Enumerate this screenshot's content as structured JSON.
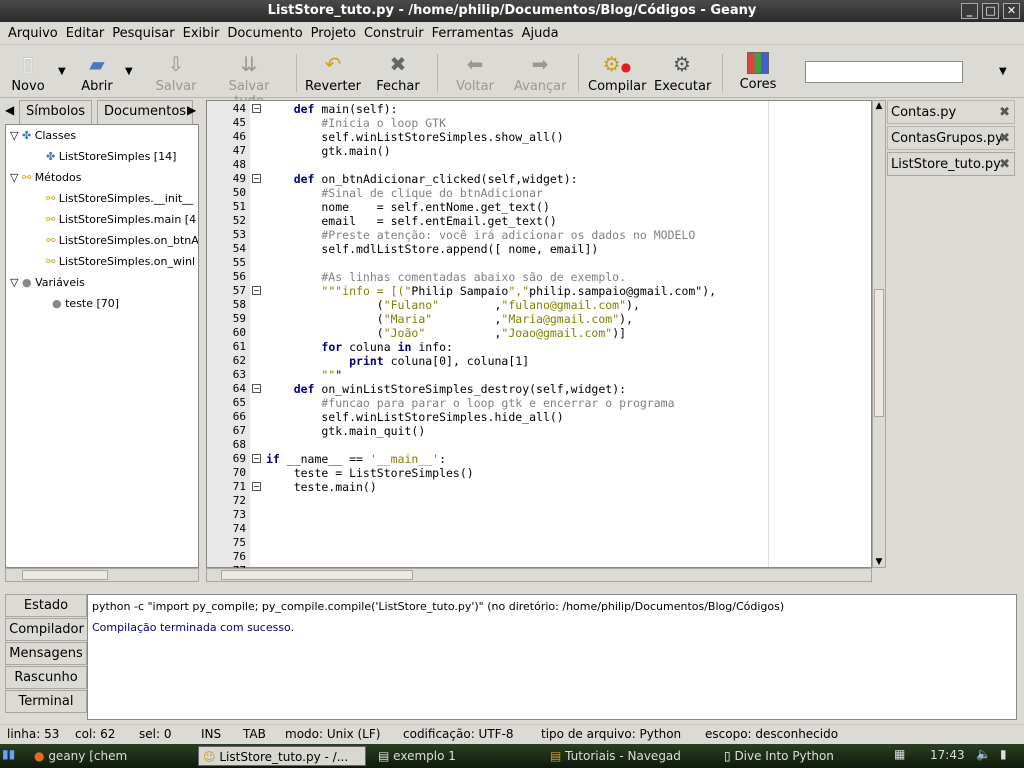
{
  "window": {
    "title": "ListStore_tuto.py - /home/philip/Documentos/Blog/Códigos - Geany"
  },
  "menu": [
    "Arquivo",
    "Editar",
    "Pesquisar",
    "Exibir",
    "Documento",
    "Projeto",
    "Construir",
    "Ferramentas",
    "Ajuda"
  ],
  "toolbar": {
    "novo": "Novo",
    "abrir": "Abrir",
    "salvar": "Salvar",
    "salvar_tudo": "Salvar tudo",
    "reverter": "Reverter",
    "fechar": "Fechar",
    "voltar": "Voltar",
    "avancar": "Avançar",
    "compilar": "Compilar",
    "executar": "Executar",
    "cores": "Cores",
    "search_value": ""
  },
  "sidebar": {
    "tabs": [
      "Símbolos",
      "Documentos"
    ],
    "tree": [
      {
        "label": "Classes",
        "level": 0
      },
      {
        "label": "ListStoreSimples [14]",
        "level": 1
      },
      {
        "label": "Métodos",
        "level": 0
      },
      {
        "label": "ListStoreSimples.__init__",
        "level": 1
      },
      {
        "label": "ListStoreSimples.main [4",
        "level": 1
      },
      {
        "label": "ListStoreSimples.on_btnA",
        "level": 1
      },
      {
        "label": "ListStoreSimples.on_winl",
        "level": 1
      },
      {
        "label": "Variáveis",
        "level": 0
      },
      {
        "label": "teste [70]",
        "level": 1
      }
    ]
  },
  "editor": {
    "line_numbers": [
      "44",
      "45",
      "46",
      "47",
      "48",
      "49",
      "50",
      "51",
      "52",
      "53",
      "54",
      "55",
      "56",
      "57",
      "58",
      "59",
      "60",
      "61",
      "62",
      "63",
      "64",
      "65",
      "66",
      "67",
      "68",
      "69",
      "70",
      "71",
      "72",
      "73",
      "74",
      "75",
      "76",
      "77"
    ],
    "lines": [
      "    def main(self):",
      "        #Inicia o loop GTK",
      "        self.winListStoreSimples.show_all()",
      "        gtk.main()",
      "",
      "    def on_btnAdicionar_clicked(self,widget):",
      "        #Sinal de clique do btnAdicionar",
      "        nome    = self.entNome.get_text()",
      "        email   = self.entEmail.get_text()",
      "        #Preste atenção: você irá adicionar os dados no MODELO",
      "        self.mdlListStore.append([ nome, email])",
      "",
      "        #As linhas comentadas abaixo são de exemplo.",
      "        \"\"\"info = [(\"Philip Sampaio\",\"philip.sampaio@gmail.com\"),",
      "                (\"Fulano\"        ,\"fulano@gmail.com\"),",
      "                (\"Maria\"         ,\"Maria@gmail.com\"),",
      "                (\"João\"          ,\"Joao@gmail.com\")]",
      "        for coluna in info:",
      "            print coluna[0], coluna[1]",
      "        \"\"\"",
      "    def on_winListStoreSimples_destroy(self,widget):",
      "        #funcao para parar o loop gtk e encerrar o programa",
      "        self.winListStoreSimples.hide_all()",
      "        gtk.main_quit()",
      "",
      "if __name__ == '__main__':",
      "    teste = ListStoreSimples()",
      "    teste.main()",
      "",
      "",
      "",
      "",
      "",
      ""
    ]
  },
  "open_files": [
    "Contas.py",
    "ContasGrupos.py",
    "ListStore_tuto.py"
  ],
  "bottom": {
    "tabs": [
      "Estado",
      "Compilador",
      "Mensagens",
      "Rascunho",
      "Terminal"
    ],
    "command": "python -c \"import py_compile; py_compile.compile('ListStore_tuto.py')\" (no diretório: /home/philip/Documentos/Blog/Códigos)",
    "result": "Compilação terminada com sucesso."
  },
  "status": {
    "linha": "linha: 53",
    "col": "col: 62",
    "sel": "sel: 0",
    "ins": "INS",
    "tab": "TAB",
    "modo": "modo: Unix (LF)",
    "codificacao": "codificação: UTF-8",
    "tipo": "tipo de arquivo: Python",
    "escopo": "escopo: desconhecido"
  },
  "taskbar": {
    "items": [
      "geany [chem",
      "ListStore_tuto.py - /...",
      "exemplo 1",
      "Tutoriais - Navegad",
      "Dive Into Python"
    ],
    "clock": "17:43"
  },
  "colors": {
    "keyword": "#00007f",
    "comment": "#808080",
    "string": "#7f7f00",
    "result": "#00007f"
  }
}
